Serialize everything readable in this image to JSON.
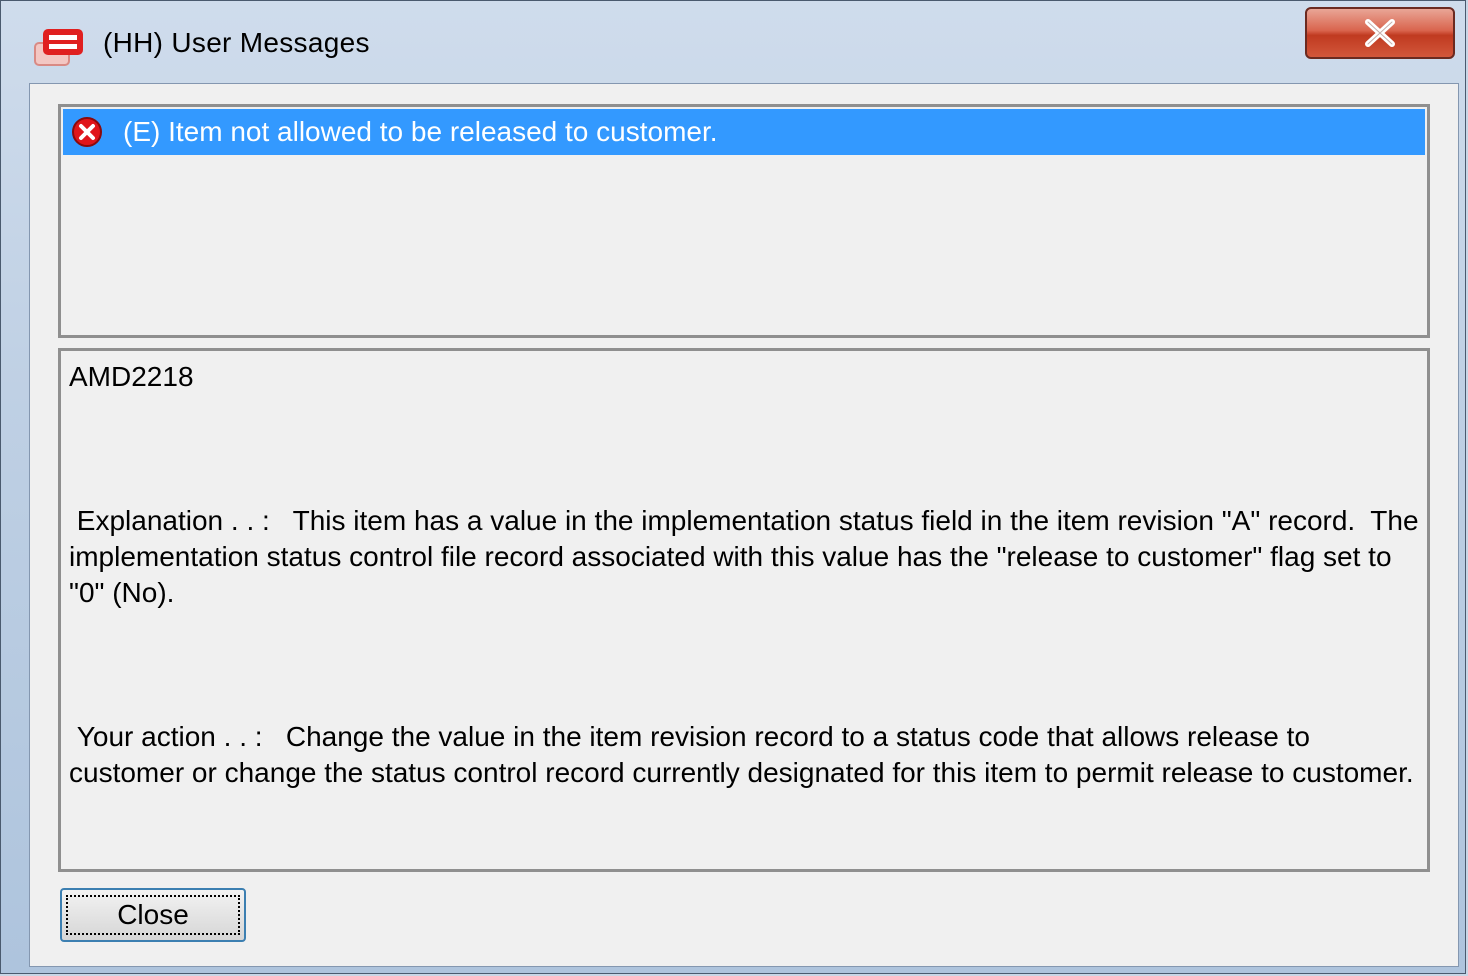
{
  "window": {
    "title": "(HH) User Messages",
    "close_glyph": "X"
  },
  "messages": [
    {
      "icon": "error-icon",
      "text": "(E) Item not allowed to be released to customer."
    }
  ],
  "detail": {
    "code": "AMD2218",
    "explanation": " Explanation . . :   This item has a value in the implementation status field in the item revision \"A\" record.  The implementation status control file record associated with this value has the \"release to customer\" flag set to \"0\" (No).",
    "action": " Your action . . :   Change the value in the item revision record to a status code that allows release to customer or change the status control record currently designated for this item to permit release to customer."
  },
  "buttons": {
    "close_label": "Close"
  },
  "colors": {
    "selection": "#3399ff",
    "error": "#e0151b",
    "dialog_bg": "#f0f0f0"
  }
}
